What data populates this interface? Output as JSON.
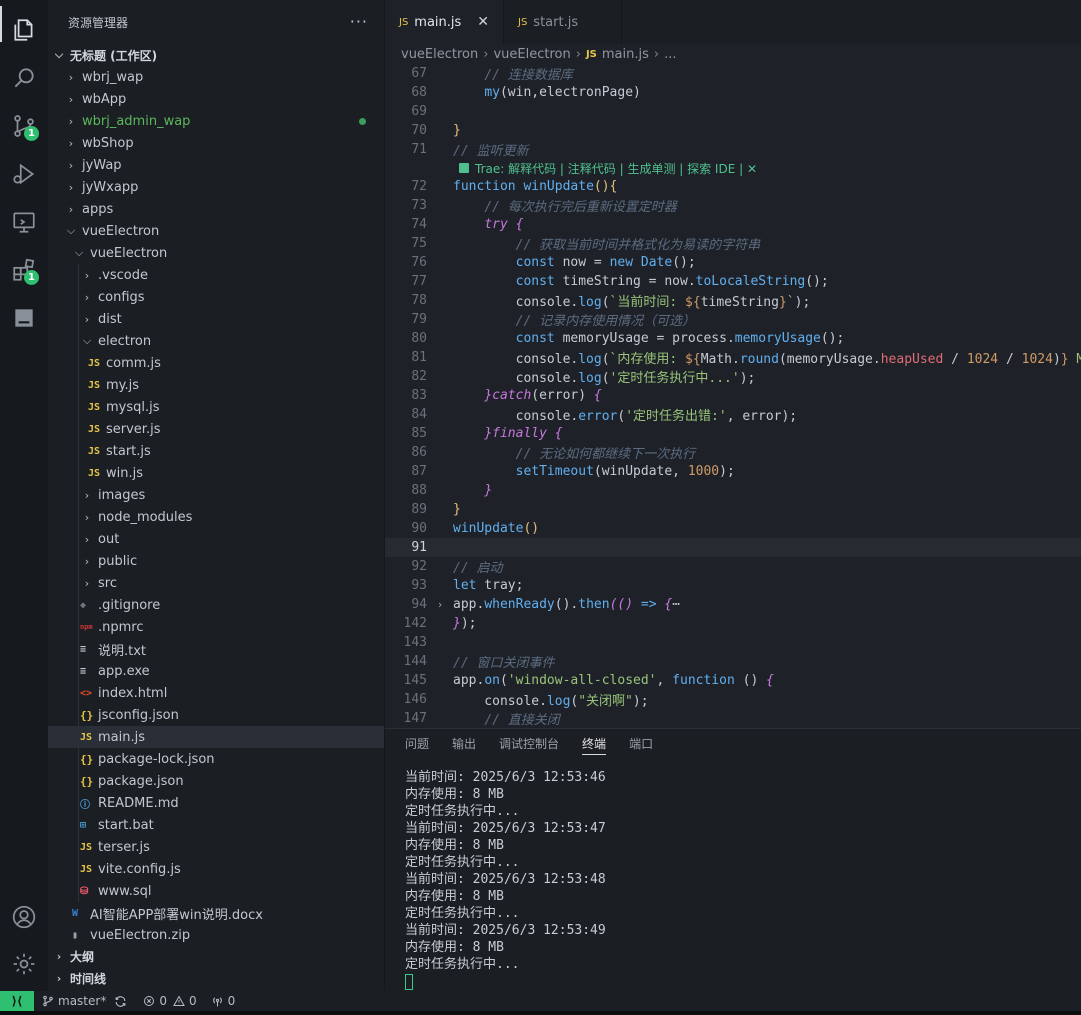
{
  "colors": {
    "accent_green": "#2fbf71",
    "editor_bg": "#1e2228",
    "sidebar_bg": "#1b1e23"
  },
  "activity": {
    "icons": [
      "explorer-icon",
      "search-icon",
      "source-control-icon",
      "run-debug-icon",
      "remote-explorer-icon",
      "extensions-icon",
      "panel-icon",
      "account-icon",
      "settings-icon"
    ],
    "source_control_badge": "1",
    "extensions_badge": "1"
  },
  "sidebar": {
    "title": "资源管理器",
    "more": "···",
    "workspace": "无标题 (工作区)",
    "items": [
      {
        "label": "wbrj_wap",
        "type": "folder"
      },
      {
        "label": "wbApp",
        "type": "folder"
      },
      {
        "label": "wbrj_admin_wap",
        "type": "folder"
      },
      {
        "label": "wbShop",
        "type": "folder"
      },
      {
        "label": "jyWap",
        "type": "folder"
      },
      {
        "label": "jyWxapp",
        "type": "folder"
      },
      {
        "label": "apps",
        "type": "folder"
      },
      {
        "label": "vueElectron",
        "type": "folder"
      },
      {
        "label": "vueElectron",
        "type": "folder"
      },
      {
        "label": ".vscode",
        "type": "folder"
      },
      {
        "label": "configs",
        "type": "folder"
      },
      {
        "label": "dist",
        "type": "folder"
      },
      {
        "label": "electron",
        "type": "folder"
      },
      {
        "label": "comm.js",
        "type": "js"
      },
      {
        "label": "my.js",
        "type": "js"
      },
      {
        "label": "mysql.js",
        "type": "js"
      },
      {
        "label": "server.js",
        "type": "js"
      },
      {
        "label": "start.js",
        "type": "js"
      },
      {
        "label": "win.js",
        "type": "js"
      },
      {
        "label": "images",
        "type": "folder"
      },
      {
        "label": "node_modules",
        "type": "folder"
      },
      {
        "label": "out",
        "type": "folder"
      },
      {
        "label": "public",
        "type": "folder"
      },
      {
        "label": "src",
        "type": "folder"
      },
      {
        "label": ".gitignore",
        "type": "file"
      },
      {
        "label": ".npmrc",
        "type": "file"
      },
      {
        "label": "说明.txt",
        "type": "file"
      },
      {
        "label": "app.exe",
        "type": "file"
      },
      {
        "label": "index.html",
        "type": "file"
      },
      {
        "label": "jsconfig.json",
        "type": "json"
      },
      {
        "label": "main.js",
        "type": "js"
      },
      {
        "label": "package-lock.json",
        "type": "json"
      },
      {
        "label": "package.json",
        "type": "json"
      },
      {
        "label": "README.md",
        "type": "file"
      },
      {
        "label": "start.bat",
        "type": "file"
      },
      {
        "label": "terser.js",
        "type": "js"
      },
      {
        "label": "vite.config.js",
        "type": "js"
      },
      {
        "label": "www.sql",
        "type": "file"
      },
      {
        "label": "AI智能APP部署win说明.docx",
        "type": "file"
      },
      {
        "label": "vueElectron.zip",
        "type": "file"
      }
    ],
    "outline": "大纲",
    "timeline": "时间线"
  },
  "editor": {
    "tabs": [
      {
        "label": "main.js",
        "icon": "JS",
        "close": "✕"
      },
      {
        "label": "start.js",
        "icon": "JS"
      }
    ],
    "breadcrumb": [
      "vueElectron",
      "vueElectron",
      "main.js",
      "..."
    ],
    "codelens": "Trae: 解释代码 | 注释代码 | 生成单测 | 探索 IDE | ✕",
    "line_numbers": [
      "67",
      "68",
      "69",
      "70",
      "71",
      "72",
      "73",
      "74",
      "75",
      "76",
      "77",
      "78",
      "79",
      "80",
      "81",
      "82",
      "83",
      "84",
      "85",
      "86",
      "87",
      "88",
      "89",
      "90",
      "91",
      "92",
      "93",
      "94",
      "142",
      "143",
      "144",
      "145",
      "146",
      "147"
    ],
    "current_line": "91"
  },
  "panel": {
    "tabs": [
      "问题",
      "输出",
      "调试控制台",
      "终端",
      "端口"
    ],
    "active_tab": "终端",
    "terminal_lines": [
      "当前时间: 2025/6/3 12:53:46",
      "内存使用: 8 MB",
      "定时任务执行中...",
      "当前时间: 2025/6/3 12:53:47",
      "内存使用: 8 MB",
      "定时任务执行中...",
      "当前时间: 2025/6/3 12:53:48",
      "内存使用: 8 MB",
      "定时任务执行中...",
      "当前时间: 2025/6/3 12:53:49",
      "内存使用: 8 MB",
      "定时任务执行中..."
    ]
  },
  "statusbar": {
    "remote": "⟩⟨",
    "branch": "master*",
    "errors": "0",
    "warnings": "0",
    "ports": "0"
  }
}
